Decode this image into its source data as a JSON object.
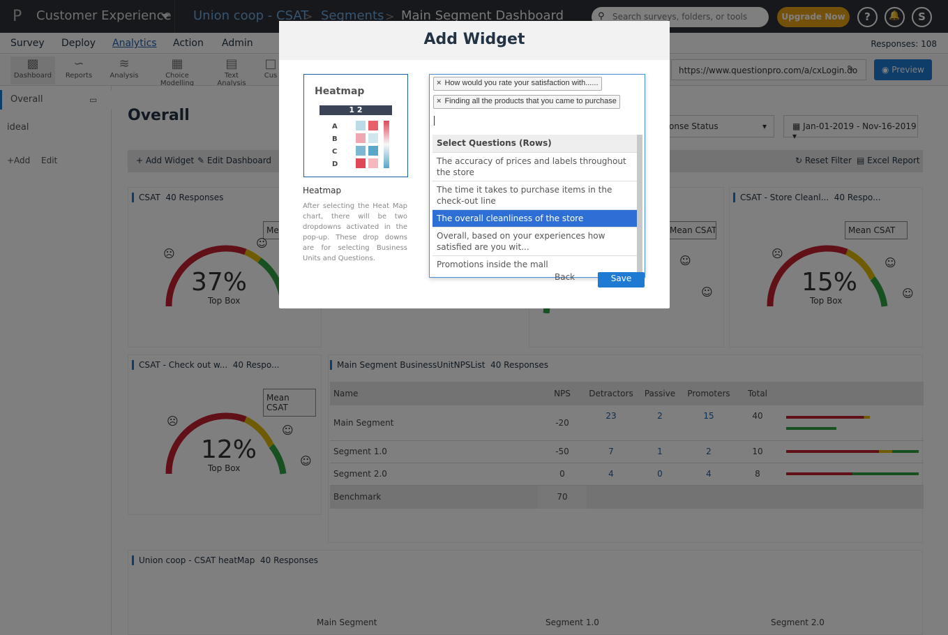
{
  "topbar": {
    "logo": "P",
    "app_name": "Customer Experience",
    "crumbs": [
      "Union coop - CSAT",
      "Segments",
      "Main Segment Dashboard"
    ],
    "crumb_sep": ">",
    "search_placeholder": "Search surveys, folders, or tools",
    "upgrade_label": "Upgrade Now",
    "help": "?",
    "user_initial": "S"
  },
  "nav": {
    "items": [
      "Survey",
      "Deploy",
      "Analytics",
      "Action",
      "Admin"
    ],
    "active": "Analytics",
    "responses": "Responses: 108"
  },
  "toolbar": {
    "tools": [
      "Dashboard",
      "Reports",
      "Analysis",
      "Choice Modelling",
      "Text Analysis",
      "Cus"
    ],
    "url": "https://www.questionpro.com/a/cxLogin.do",
    "preview_label": "Preview"
  },
  "sidebar": {
    "items": [
      "Overall",
      "ideal"
    ],
    "add_label": "+Add",
    "edit_label": "Edit"
  },
  "main": {
    "title": "Overall",
    "add_widget": "Add Widget",
    "edit_dashboard": "Edit Dashboard",
    "status_filter": "onse Status",
    "date_range": "Jan-01-2019 - Nov-16-2019",
    "reset_filter": "Reset Filter",
    "excel_report": "Excel Report"
  },
  "widgets": {
    "csat": {
      "title": "CSAT",
      "responses": "40 Responses",
      "mean": "Mea",
      "pct": "37%",
      "label": "Top Box"
    },
    "middle": {
      "mean": "Mean CSAT"
    },
    "store": {
      "title": "CSAT - Store Cleanl...",
      "responses": "40 Respo...",
      "mean": "Mean CSAT",
      "pct": "15%",
      "label": "Top Box"
    },
    "checkout": {
      "title": "CSAT - Check out w...",
      "responses": "40 Respo...",
      "mean": "Mean CSAT",
      "pct": "12%",
      "label": "Top Box"
    },
    "nps": {
      "title": "Main Segment BusinessUnitNPSList",
      "responses": "40 Responses",
      "headers": [
        "Name",
        "NPS",
        "Detractors",
        "Passive",
        "Promoters",
        "Total"
      ],
      "rows": [
        {
          "name": "Main Segment",
          "nps": "-20",
          "det": "23",
          "pas": "2",
          "pro": "15",
          "tot": "40"
        },
        {
          "name": "Segment 1.0",
          "nps": "-50",
          "det": "7",
          "pas": "1",
          "pro": "2",
          "tot": "10"
        },
        {
          "name": "Segment 2.0",
          "nps": "0",
          "det": "4",
          "pas": "0",
          "pro": "4",
          "tot": "8"
        }
      ],
      "benchmark": {
        "name": "Benchmark",
        "nps": "70"
      }
    },
    "heatmap": {
      "title": "Union coop - CSAT heatMap",
      "responses": "40 Responses",
      "columns": [
        "Main Segment",
        "Segment 1.0",
        "Segment 2.0"
      ]
    }
  },
  "modal": {
    "title": "Add Widget",
    "card_title": "Heatmap",
    "preview_cols": "1 2",
    "preview_rows": [
      "A",
      "B",
      "C",
      "D"
    ],
    "widget_name": "Heatmap",
    "description": "After selecting the Heat Map chart, there will be two dropdowns activated in the pop-up. These drop downs are for selecting Business Units and Questions.",
    "chips": [
      "How would you rate your satisfaction with......",
      "Finding all the products that you came to purchase"
    ],
    "dropdown_header": "Select Questions (Rows)",
    "options": [
      "The accuracy of prices and labels throughout the store",
      "The time it takes to purchase items in the check-out line",
      "The overall cleanliness of the store",
      "Overall, based on your experiences how satisfied are you wit...",
      "Promotions inside the mall"
    ],
    "highlighted": "The overall cleanliness of the store",
    "back_label": "Back",
    "save_label": "Save"
  },
  "colors": {
    "accent": "#1f7ad4",
    "upgrade": "#e8a317",
    "gauge_red": "#c0202d",
    "gauge_yellow": "#e0b800",
    "gauge_green": "#2ea043"
  }
}
